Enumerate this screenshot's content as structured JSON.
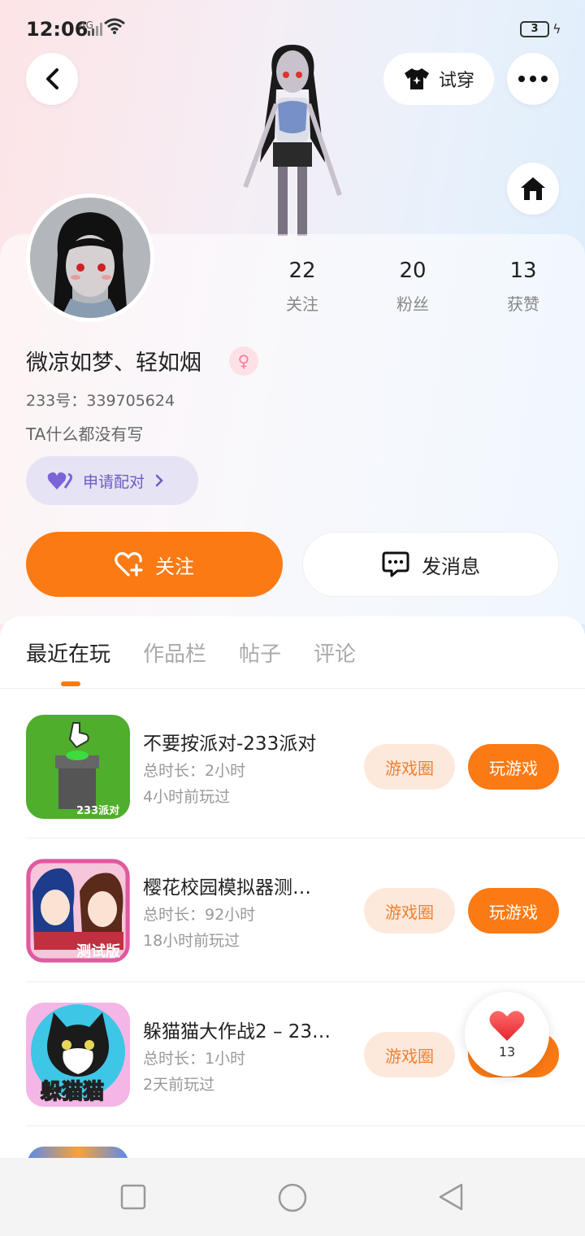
{
  "status": {
    "time": "12:06",
    "network": "4G",
    "battery": "3"
  },
  "header": {
    "tryon_label": "试穿"
  },
  "stats": [
    {
      "num": "22",
      "label": "关注"
    },
    {
      "num": "20",
      "label": "粉丝"
    },
    {
      "num": "13",
      "label": "获赞"
    }
  ],
  "profile": {
    "nickname": "微凉如梦、轻如烟",
    "uid": "233号：339705624",
    "bio": "TA什么都没有写",
    "pair_label": "申请配对"
  },
  "actions": {
    "follow_label": "关注",
    "message_label": "发消息"
  },
  "tabs": [
    "最近在玩",
    "作品栏",
    "帖子",
    "评论"
  ],
  "games": [
    {
      "title": "不要按派对-233派对",
      "duration": "总时长：2小时",
      "last_played": "4小时前玩过",
      "circle_label": "游戏圈",
      "play_label": "玩游戏",
      "icon_label": "233派对"
    },
    {
      "title": "樱花校园模拟器测…",
      "duration": "总时长：92小时",
      "last_played": "18小时前玩过",
      "circle_label": "游戏圈",
      "play_label": "玩游戏",
      "icon_label": "测试版"
    },
    {
      "title": "躲猫猫大作战2 – 23…",
      "duration": "总时长：1小时",
      "last_played": "2天前玩过",
      "circle_label": "游戏圈",
      "play_label": "玩游戏",
      "icon_label": "躲猫猫"
    }
  ],
  "like_count": "13",
  "colors": {
    "accent": "#fb7a14",
    "pair": "#6a5dc5"
  }
}
